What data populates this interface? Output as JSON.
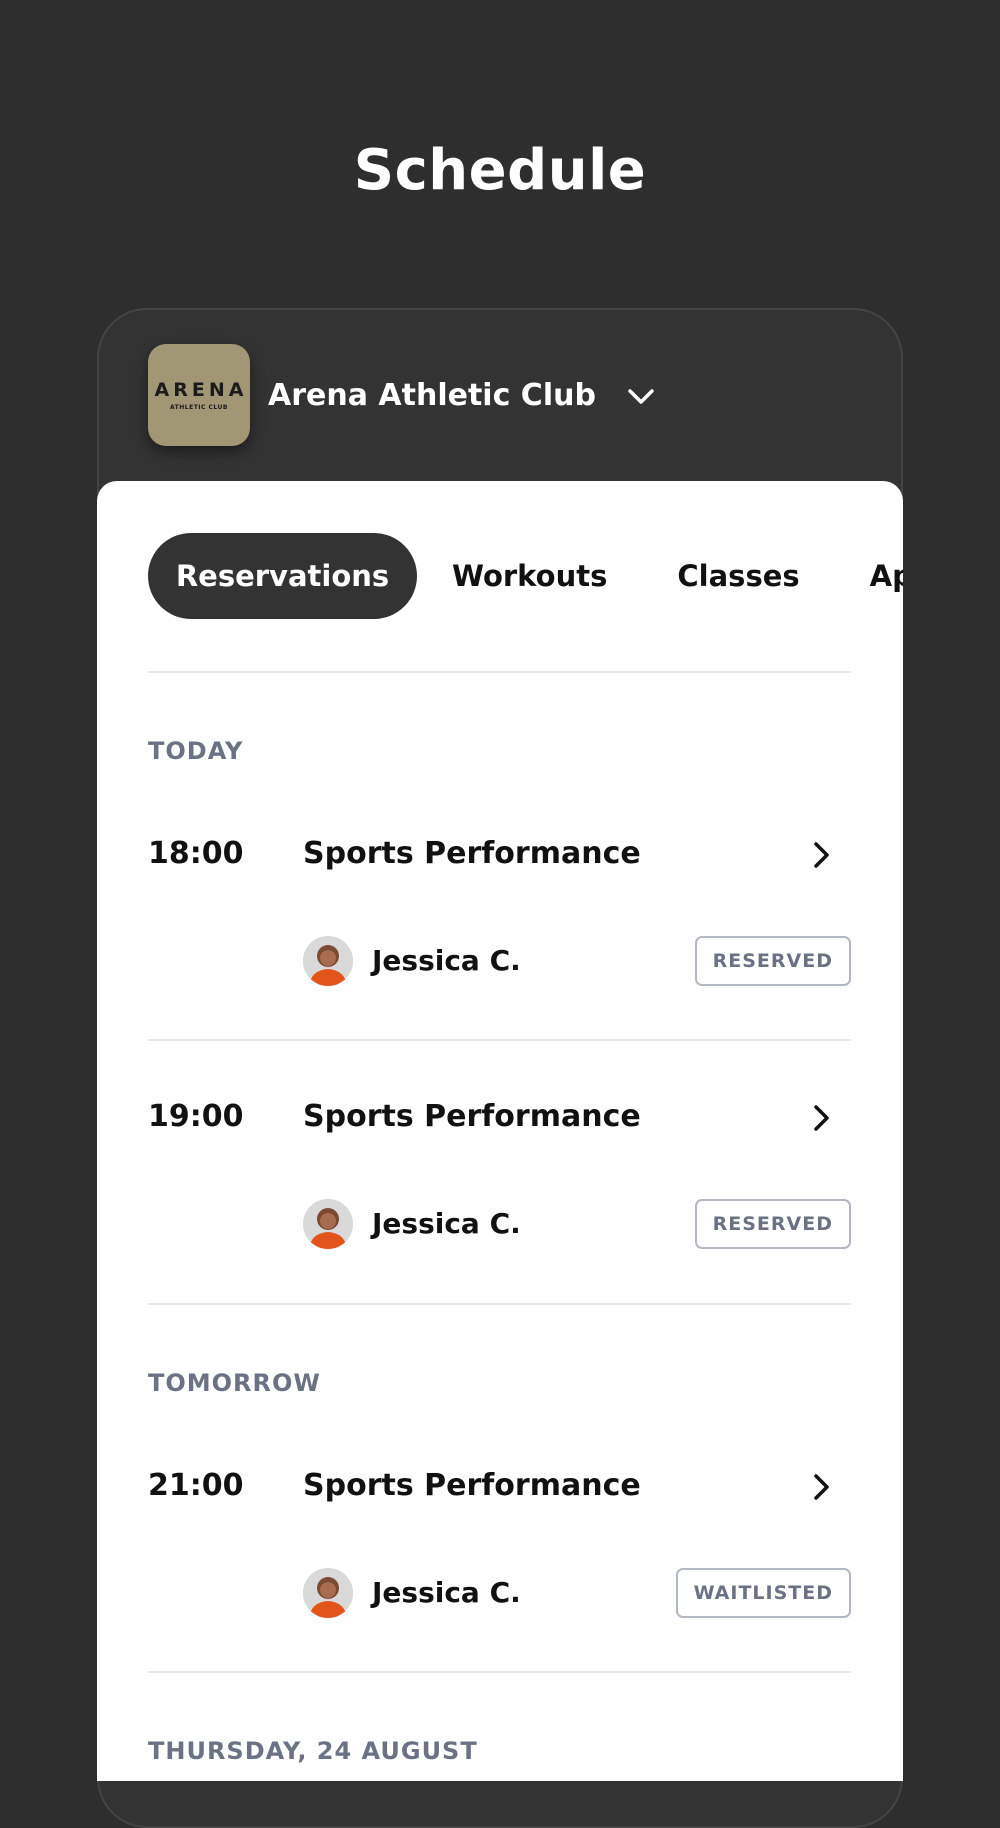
{
  "page": {
    "title": "Schedule"
  },
  "club": {
    "logo_main": "ARENA",
    "logo_sub": "ATHLETIC CLUB",
    "name": "Arena Athletic Club",
    "dropdown_icon": "chevron-down-icon"
  },
  "tabs": [
    {
      "label": "Reservations",
      "active": true
    },
    {
      "label": "Workouts",
      "active": false
    },
    {
      "label": "Classes",
      "active": false
    },
    {
      "label": "Appointments",
      "active": false
    }
  ],
  "sections": [
    {
      "label": "TODAY",
      "items": [
        {
          "time": "18:00",
          "title": "Sports Performance",
          "coach": "Jessica C.",
          "status": "RESERVED"
        },
        {
          "time": "19:00",
          "title": "Sports Performance",
          "coach": "Jessica C.",
          "status": "RESERVED"
        }
      ]
    },
    {
      "label": "TOMORROW",
      "items": [
        {
          "time": "21:00",
          "title": "Sports Performance",
          "coach": "Jessica C.",
          "status": "WAITLISTED"
        }
      ]
    },
    {
      "label": "THURSDAY, 24 AUGUST",
      "items": []
    }
  ],
  "colors": {
    "background": "#2e2e2e",
    "logo_gold": "#a29774",
    "active_tab": "#333333",
    "status_text": "#6a7283",
    "avatar_jersey": "#e2541b"
  }
}
